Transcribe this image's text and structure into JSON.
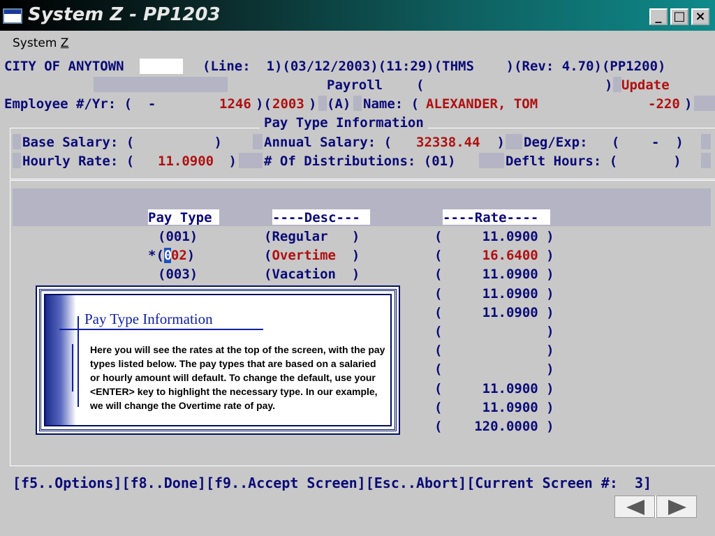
{
  "window": {
    "title": "System Z - PP1203",
    "minimize": "_",
    "maximize": "□",
    "close": "×"
  },
  "menu": {
    "system_label": "System Z"
  },
  "header": {
    "org": "CITY OF ANYTOWN",
    "line_info": "(Line:  1)(03/12/2003)(11:29)(THMS    )(Rev: 4.70)(PP1200)",
    "module": "Payroll",
    "open_paren": "(",
    "close_paren": ")",
    "mode": "Update",
    "emp_label": "Employee #/Yr: (  -     ",
    "emp_num": "1246",
    "emp_mid": ")(",
    "emp_year": "2003",
    "emp_close": ")",
    "status": "(A)",
    "name_label": "Name: (",
    "name": "ALEXANDER, TOM",
    "name_num": "-220",
    "name_close": ")"
  },
  "pay_info": {
    "section_title": "Pay Type Information",
    "base_salary_label": "Base Salary: (          )",
    "annual_salary_label": "Annual Salary: ( ",
    "annual_salary": "32338.44",
    "annual_close": " )",
    "deg_exp_label": "Deg/Exp:   (    -  )",
    "hourly_rate_label": "Hourly Rate: ( ",
    "hourly_rate": "11.0900",
    "hourly_close": " )",
    "distributions_label": "# Of Distributions: (01)",
    "deflt_hours_label": "Deflt Hours: (       )"
  },
  "table": {
    "headers": {
      "pay_type": "Pay Type",
      "desc": "----Desc---",
      "rate": "----Rate----"
    },
    "rows": [
      {
        "type": "(001)",
        "desc": "(Regular   )",
        "rate": "(     11.0900 )",
        "highlight": false
      },
      {
        "type": "*(002)",
        "desc": "(Overtime  )",
        "rate": "(     16.6400 )",
        "highlight": true
      },
      {
        "type": "(003)",
        "desc": "(Vacation  )",
        "rate": "(     11.0900 )",
        "highlight": false
      },
      {
        "type": "",
        "desc": "",
        "rate": "(     11.0900 )",
        "highlight": false
      },
      {
        "type": "",
        "desc": "",
        "rate": "(     11.0900 )",
        "highlight": false
      },
      {
        "type": "",
        "desc": "",
        "rate": "(             )",
        "highlight": false
      },
      {
        "type": "",
        "desc": "",
        "rate": "(             )",
        "highlight": false
      },
      {
        "type": "",
        "desc": "",
        "rate": "(             )",
        "highlight": false
      },
      {
        "type": "",
        "desc": "",
        "rate": "(     11.0900 )",
        "highlight": false
      },
      {
        "type": "",
        "desc": "",
        "rate": "(     11.0900 )",
        "highlight": false
      },
      {
        "type": "",
        "desc": "",
        "rate": "(    120.0000 )",
        "highlight": false
      }
    ]
  },
  "footer": {
    "keys": "[f5..Options][f8..Done][f9..Accept Screen][Esc..Abort][Current Screen #:  3]"
  },
  "tooltip": {
    "title": "Pay Type Information",
    "body": "Here you will see the rates at the top of the screen, with the pay types listed below.  The pay types that are based on a salaried or hourly amount will default.  To change the default, use your <ENTER> key to highlight the necessary type.  In our example, we will change the Overtime rate of pay."
  },
  "colors": {
    "terminal_text": "#0a0a78",
    "value_text": "#b01010",
    "background": "#c8c8c8"
  }
}
